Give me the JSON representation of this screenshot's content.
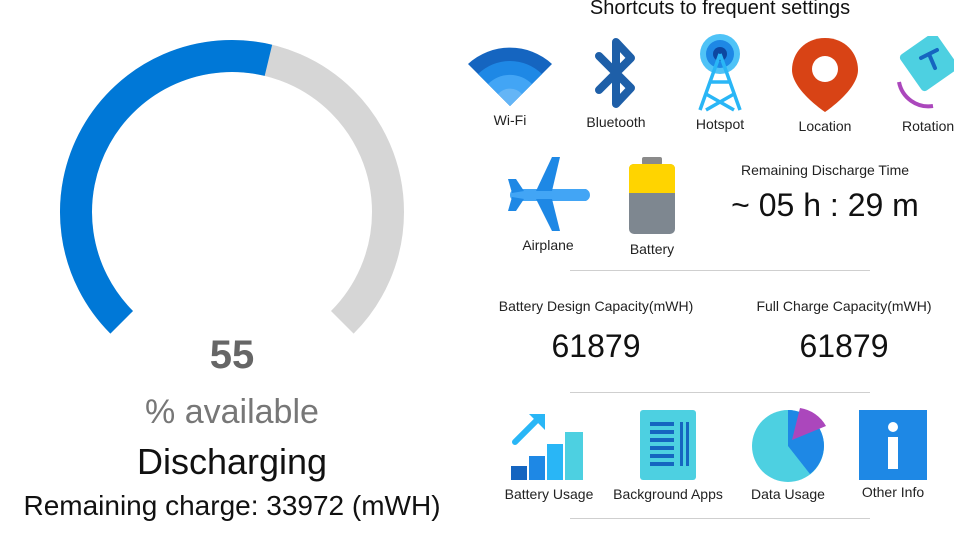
{
  "battery": {
    "percent": 55,
    "percent_text": "55",
    "available_label": "% available",
    "status": "Discharging",
    "remaining_charge": "Remaining charge: 33972 (mWH)"
  },
  "colors": {
    "accent": "#0078D7",
    "track": "#D6D6D6"
  },
  "shortcuts": {
    "title": "Shortcuts to frequent settings",
    "items": [
      {
        "label": "Wi-Fi",
        "icon": "wifi-icon"
      },
      {
        "label": "Bluetooth",
        "icon": "bluetooth-icon"
      },
      {
        "label": "Hotspot",
        "icon": "hotspot-icon"
      },
      {
        "label": "Location",
        "icon": "location-icon"
      },
      {
        "label": "Rotation",
        "icon": "rotation-icon"
      },
      {
        "label": "Airplane",
        "icon": "airplane-icon"
      },
      {
        "label": "Battery",
        "icon": "battery-icon"
      }
    ]
  },
  "discharge": {
    "label": "Remaining Discharge Time",
    "value": "~ 05 h : 29 m"
  },
  "capacity": {
    "design_label": "Battery Design Capacity(mWH)",
    "design_value": "61879",
    "full_label": "Full Charge Capacity(mWH)",
    "full_value": "61879"
  },
  "tools": [
    {
      "label": "Battery Usage",
      "icon": "battery-usage-icon"
    },
    {
      "label": "Background Apps",
      "icon": "background-apps-icon"
    },
    {
      "label": "Data Usage",
      "icon": "data-usage-icon"
    },
    {
      "label": "Other Info",
      "icon": "info-icon"
    }
  ]
}
